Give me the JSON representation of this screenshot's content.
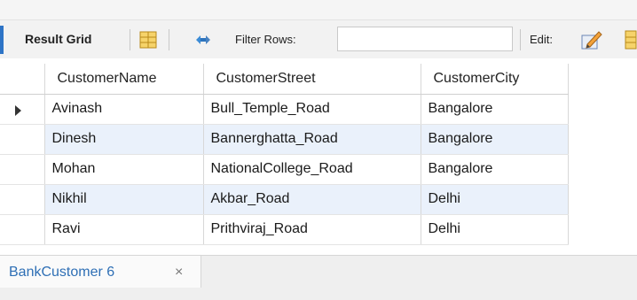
{
  "toolbar": {
    "result_grid_label": "Result Grid",
    "filter_label": "Filter Rows:",
    "filter_value": "",
    "edit_label": "Edit:"
  },
  "icons": {
    "grid_view": "grid-icon",
    "refresh": "refresh-icon",
    "edit": "edit-icon"
  },
  "grid": {
    "columns": [
      "CustomerName",
      "CustomerStreet",
      "CustomerCity"
    ],
    "rows": [
      {
        "name": "Avinash",
        "street": "Bull_Temple_Road",
        "city": "Bangalore"
      },
      {
        "name": "Dinesh",
        "street": "Bannerghatta_Road",
        "city": "Bangalore"
      },
      {
        "name": "Mohan",
        "street": "NationalCollege_Road",
        "city": "Bangalore"
      },
      {
        "name": "Nikhil",
        "street": "Akbar_Road",
        "city": "Delhi"
      },
      {
        "name": "Ravi",
        "street": "Prithviraj_Road",
        "city": "Delhi"
      }
    ],
    "selected_row": 0
  },
  "tabs": [
    {
      "label": "BankCustomer 6",
      "close": "×"
    }
  ],
  "colors": {
    "accent": "#2e74c6",
    "alt_row": "#eaf1fb",
    "tab_text": "#2e6fb5"
  }
}
